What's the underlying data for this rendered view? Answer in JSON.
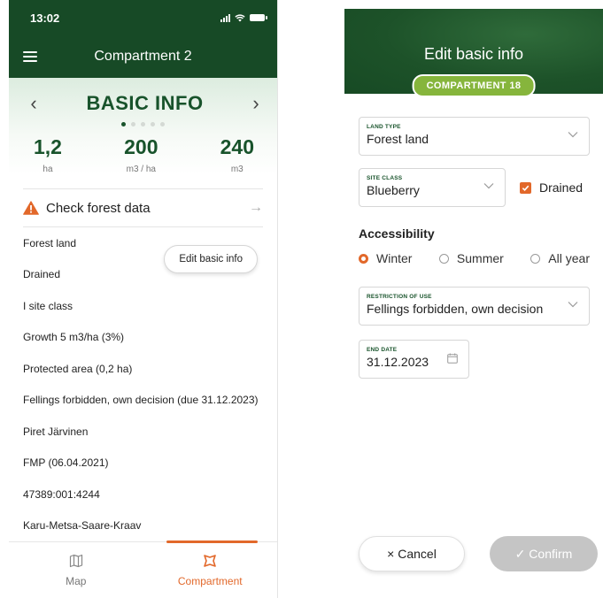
{
  "left": {
    "status_bar": {
      "time": "13:02"
    },
    "header": {
      "title": "Compartment 2"
    },
    "info": {
      "title": "BASIC INFO",
      "prev_arrow": "‹",
      "next_arrow": "›",
      "page_count": 5,
      "active_page": 1,
      "stats": [
        {
          "value": "1,2",
          "unit": "ha"
        },
        {
          "value": "200",
          "unit": "m3 / ha"
        },
        {
          "value": "240",
          "unit": "m3"
        }
      ]
    },
    "check": {
      "label": "Check forest data",
      "arrow": "→",
      "icon": "warning-icon",
      "icon_color": "#e2682a"
    },
    "edit_button": "Edit basic info",
    "details": [
      "Forest land",
      "Drained",
      "I site class",
      "Growth 5 m3/ha (3%)",
      "Protected area (0,2 ha)",
      "Fellings forbidden, own decision (due 31.12.2023)",
      "Piret Järvinen",
      "FMP (06.04.2021)",
      "47389:001:4244",
      "Karu-Metsa-Saare-Kraav"
    ],
    "tabs": [
      {
        "label": "Map",
        "icon": "map-icon"
      },
      {
        "label": "Compartment",
        "icon": "compartment-icon"
      }
    ]
  },
  "right": {
    "header": {
      "title": "Edit basic info",
      "badge": "COMPARTMENT 18"
    },
    "land_type": {
      "label": "LAND TYPE",
      "value": "Forest land"
    },
    "site_class": {
      "label": "SITE CLASS",
      "value": "Blueberry"
    },
    "drained": {
      "label": "Drained",
      "checked": true
    },
    "accessibility": {
      "title": "Accessibility",
      "options": [
        {
          "label": "Winter",
          "selected": true
        },
        {
          "label": "Summer",
          "selected": false
        },
        {
          "label": "All year",
          "selected": false
        }
      ]
    },
    "restriction": {
      "label": "RESTRICTION OF USE",
      "value": "Fellings forbidden, own decision"
    },
    "end_date": {
      "label": "END DATE",
      "value": "31.12.2023"
    },
    "buttons": {
      "cancel": "× Cancel",
      "confirm": "✓ Confirm"
    }
  },
  "colors": {
    "brand_green": "#174a26",
    "accent_orange": "#e2682a",
    "badge_green": "#86b53c",
    "disabled_gray": "#c5c5c5"
  }
}
